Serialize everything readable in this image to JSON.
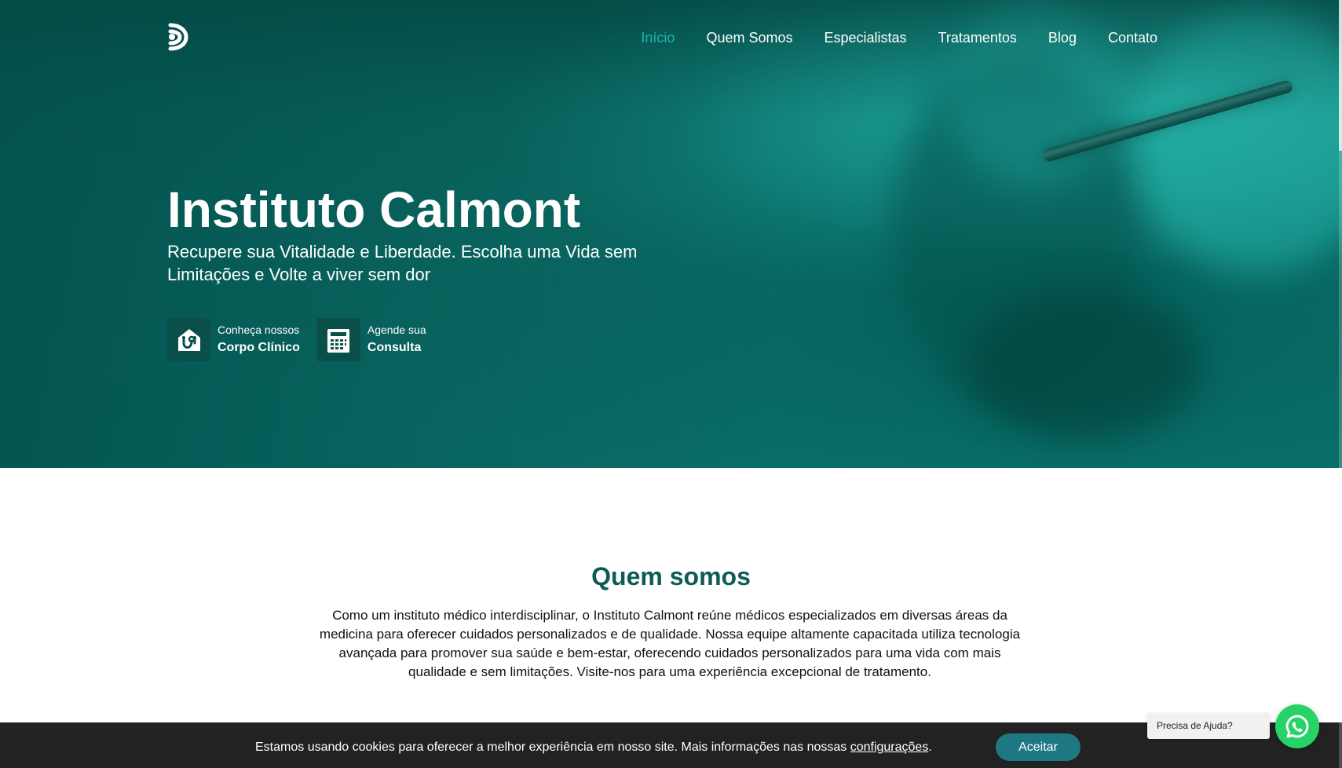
{
  "navigation": {
    "items": [
      {
        "label": "Início",
        "active": true
      },
      {
        "label": "Quem Somos",
        "active": false
      },
      {
        "label": "Especialistas",
        "active": false
      },
      {
        "label": "Tratamentos",
        "active": false
      },
      {
        "label": "Blog",
        "active": false
      },
      {
        "label": "Contato",
        "active": false
      }
    ]
  },
  "hero": {
    "title": "Instituto Calmont",
    "subtitle": "Recupere sua Vitalidade e Liberdade. Escolha uma Vida sem Limitações e Volte a viver sem dor",
    "actions": [
      {
        "top": "Conheça nossos",
        "bottom": "Corpo Clínico",
        "icon": "stethoscope-home-icon"
      },
      {
        "top": "Agende sua",
        "bottom": "Consulta",
        "icon": "calendar-icon"
      }
    ]
  },
  "about": {
    "title": "Quem somos",
    "text": "Como um instituto médico interdisciplinar, o Instituto Calmont reúne médicos especializados em diversas áreas da medicina para oferecer cuidados personalizados e de qualidade. Nossa equipe altamente capacitada utiliza tecnologia avançada para promover sua saúde e bem-estar, oferecendo cuidados personalizados para uma vida com mais qualidade e sem limitações. Visite-nos para uma experiência excepcional de tratamento."
  },
  "cookie": {
    "text_before": "Estamos usando cookies para oferecer a melhor experiência em nosso site. Mais informações nas nossas ",
    "link": "configurações",
    "text_after": ".",
    "accept": "Aceitar"
  },
  "help": {
    "tooltip": "Precisa de Ajuda?",
    "icon": "whatsapp-icon"
  },
  "colors": {
    "accent": "#17b7ad",
    "hero_dark": "#0b4f4a",
    "heading": "#0c5b55",
    "cookie_background": "#222222",
    "accept_button": "#1d7884",
    "whatsapp": "#25d366"
  }
}
